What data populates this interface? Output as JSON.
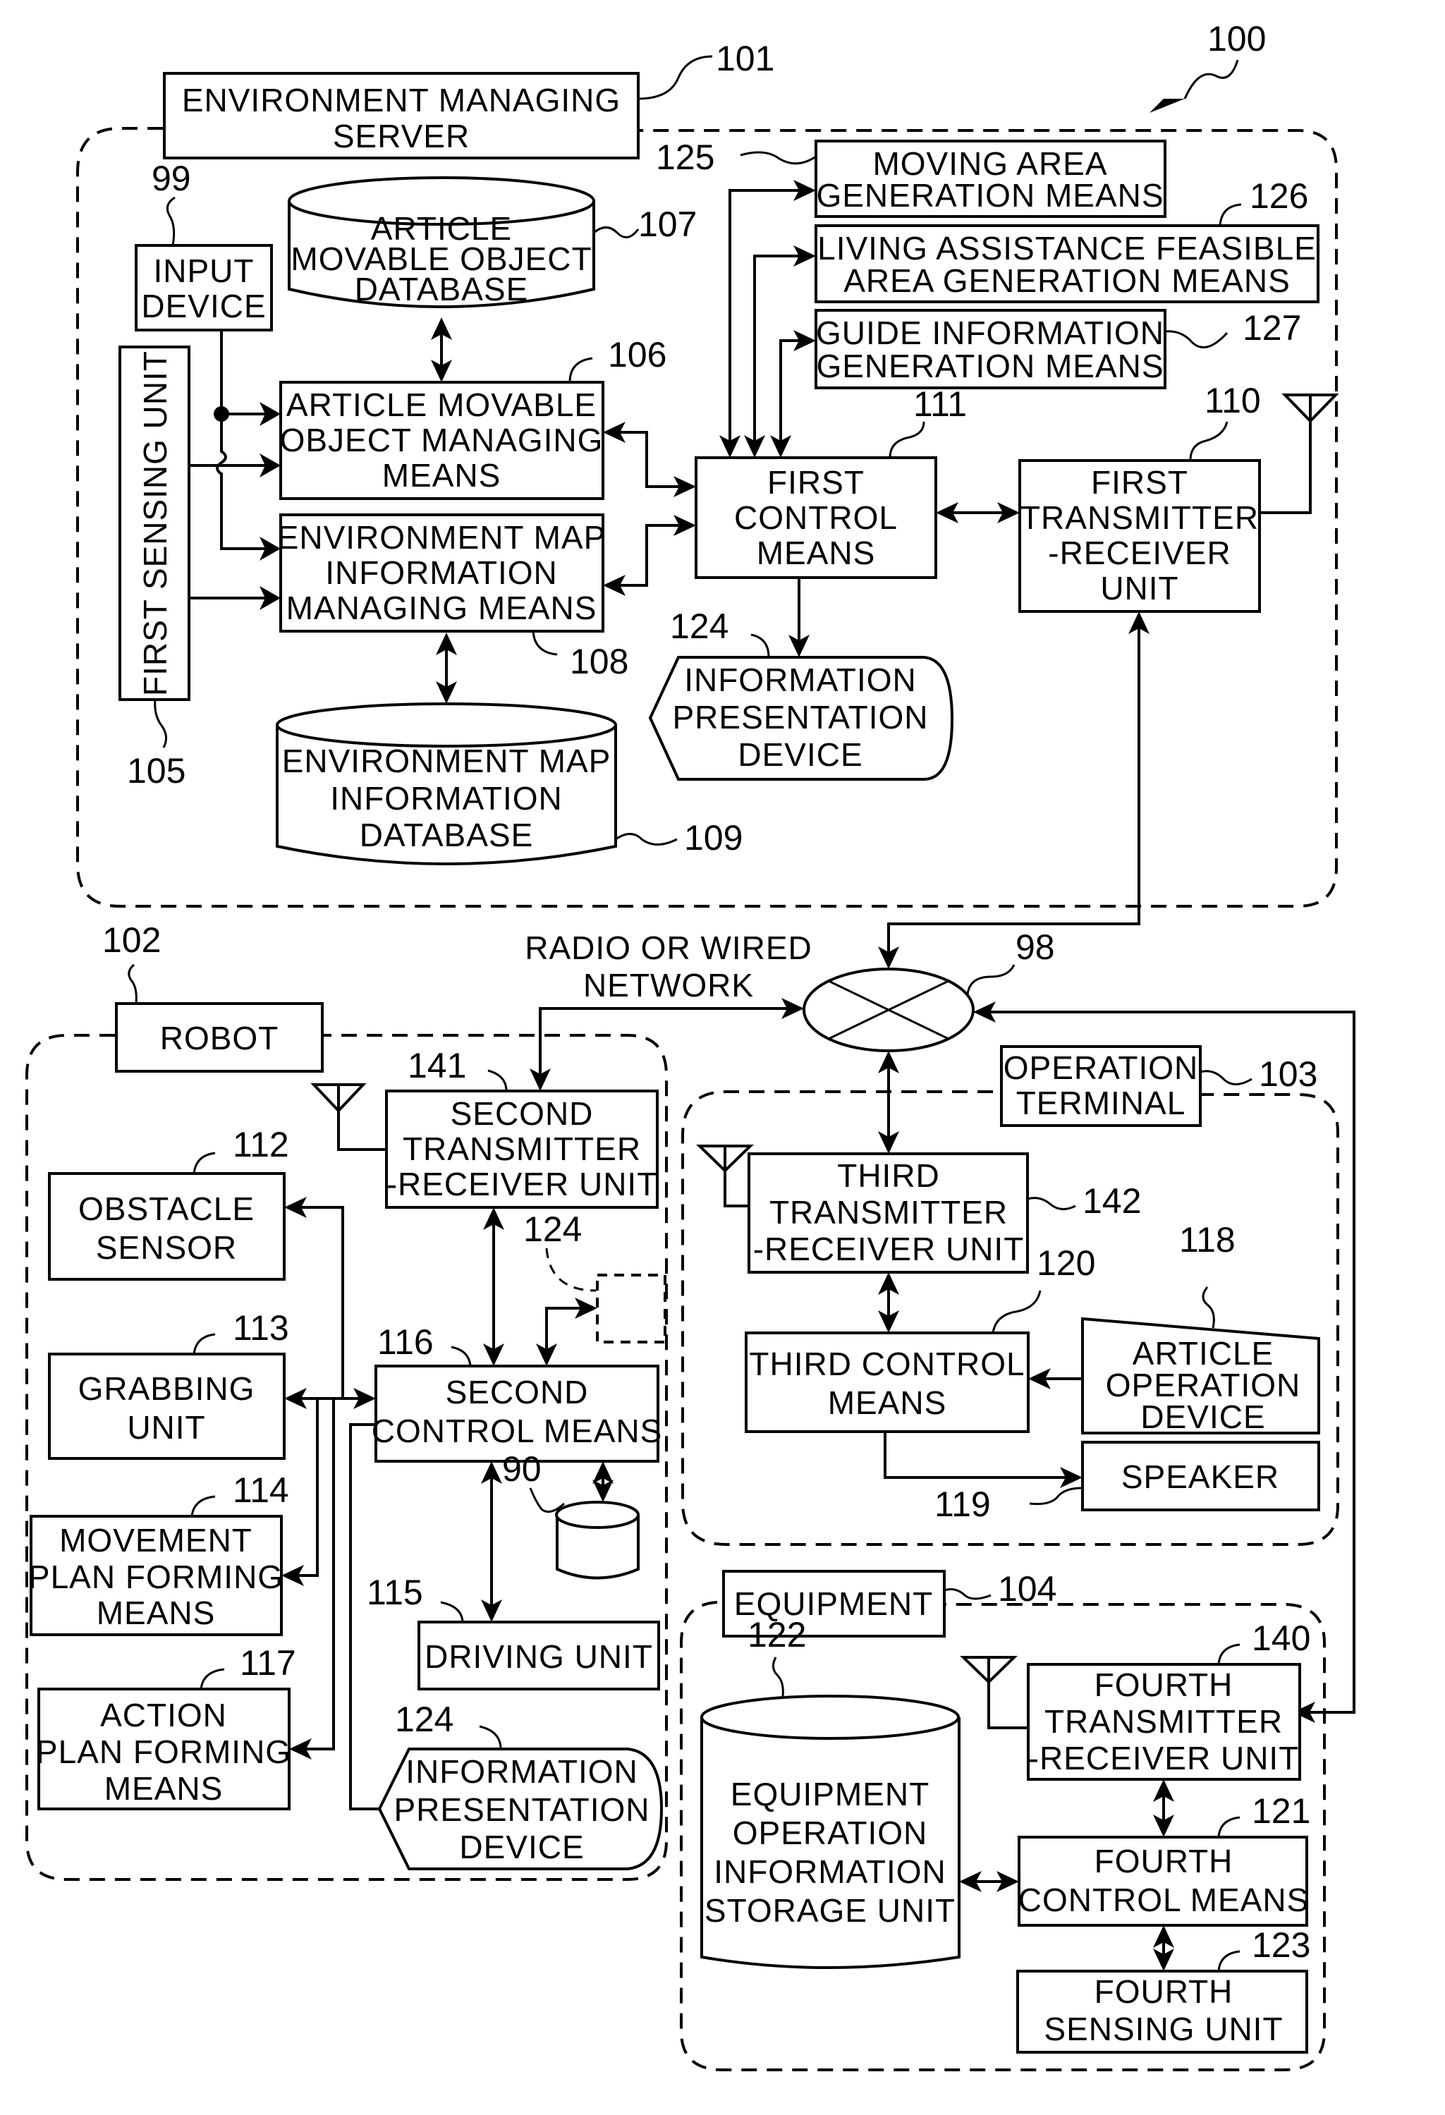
{
  "figure": {
    "system_ref": "100",
    "network": {
      "ref": "98",
      "label_lines": [
        "RADIO OR WIRED",
        "NETWORK"
      ]
    }
  },
  "server": {
    "title_lines": [
      "ENVIRONMENT MANAGING",
      "SERVER"
    ],
    "ref": "101",
    "components": {
      "input_device": {
        "lines": [
          "INPUT",
          "DEVICE"
        ],
        "ref": "99"
      },
      "first_sensing_unit": {
        "lines": [
          "FIRST SENSING UNIT"
        ],
        "ref": "105"
      },
      "article_db": {
        "lines": [
          "ARTICLE",
          "MOVABLE OBJECT",
          "DATABASE"
        ],
        "ref": "107"
      },
      "article_managing": {
        "lines": [
          "ARTICLE MOVABLE",
          "OBJECT MANAGING",
          "MEANS"
        ],
        "ref": "106"
      },
      "env_map_managing": {
        "lines": [
          "ENVIRONMENT MAP",
          "INFORMATION",
          "MANAGING MEANS"
        ],
        "ref": "108"
      },
      "env_map_db": {
        "lines": [
          "ENVIRONMENT MAP",
          "INFORMATION",
          "DATABASE"
        ],
        "ref": "109"
      },
      "moving_area": {
        "lines": [
          "MOVING AREA",
          "GENERATION MEANS"
        ],
        "ref": "125"
      },
      "living_assistance": {
        "lines": [
          "LIVING ASSISTANCE FEASIBLE",
          "AREA GENERATION MEANS"
        ],
        "ref": "126"
      },
      "guide_info": {
        "lines": [
          "GUIDE INFORMATION",
          "GENERATION MEANS"
        ],
        "ref": "127"
      },
      "first_control": {
        "lines": [
          "FIRST",
          "CONTROL",
          "MEANS"
        ],
        "ref": "111"
      },
      "first_transceiver": {
        "lines": [
          "FIRST",
          "TRANSMITTER",
          "-RECEIVER",
          "UNIT"
        ],
        "ref": "110"
      },
      "info_presentation": {
        "lines": [
          "INFORMATION",
          "PRESENTATION",
          "DEVICE"
        ],
        "ref": "124"
      }
    }
  },
  "robot": {
    "title": "ROBOT",
    "ref": "102",
    "components": {
      "second_transceiver": {
        "lines": [
          "SECOND",
          "TRANSMITTER",
          "-RECEIVER UNIT"
        ],
        "ref": "141"
      },
      "obstacle_sensor": {
        "lines": [
          "OBSTACLE",
          "SENSOR"
        ],
        "ref": "112"
      },
      "grabbing_unit": {
        "lines": [
          "GRABBING",
          "UNIT"
        ],
        "ref": "113"
      },
      "second_control": {
        "lines": [
          "SECOND",
          "CONTROL MEANS"
        ],
        "ref": "116"
      },
      "optional_info_presentation": {
        "ref": "124"
      },
      "movement_plan": {
        "lines": [
          "MOVEMENT",
          "PLAN FORMING",
          "MEANS"
        ],
        "ref": "114"
      },
      "action_plan": {
        "lines": [
          "ACTION",
          "PLAN FORMING",
          "MEANS"
        ],
        "ref": "117"
      },
      "storage": {
        "ref": "90"
      },
      "driving_unit": {
        "lines": [
          "DRIVING UNIT"
        ],
        "ref": "115"
      },
      "info_presentation": {
        "lines": [
          "INFORMATION",
          "PRESENTATION",
          "DEVICE"
        ],
        "ref": "124"
      }
    }
  },
  "operation_terminal": {
    "title_lines": [
      "OPERATION",
      "TERMINAL"
    ],
    "ref": "103",
    "components": {
      "third_transceiver": {
        "lines": [
          "THIRD",
          "TRANSMITTER",
          "-RECEIVER UNIT"
        ],
        "ref": "142"
      },
      "third_control": {
        "lines": [
          "THIRD CONTROL",
          "MEANS"
        ],
        "ref": "120"
      },
      "article_operation": {
        "lines": [
          "ARTICLE",
          "OPERATION",
          "DEVICE"
        ],
        "ref": "118"
      },
      "speaker": {
        "lines": [
          "SPEAKER"
        ],
        "ref": "119"
      }
    }
  },
  "equipment": {
    "title": "EQUIPMENT",
    "ref": "104",
    "components": {
      "equipment_db": {
        "lines": [
          "EQUIPMENT",
          "OPERATION",
          "INFORMATION",
          "STORAGE UNIT"
        ],
        "ref": "122"
      },
      "fourth_transceiver": {
        "lines": [
          "FOURTH",
          "TRANSMITTER",
          "-RECEIVER UNIT"
        ],
        "ref": "140"
      },
      "fourth_control": {
        "lines": [
          "FOURTH",
          "CONTROL MEANS"
        ],
        "ref": "121"
      },
      "fourth_sensing": {
        "lines": [
          "FOURTH",
          "SENSING UNIT"
        ],
        "ref": "123"
      }
    }
  }
}
